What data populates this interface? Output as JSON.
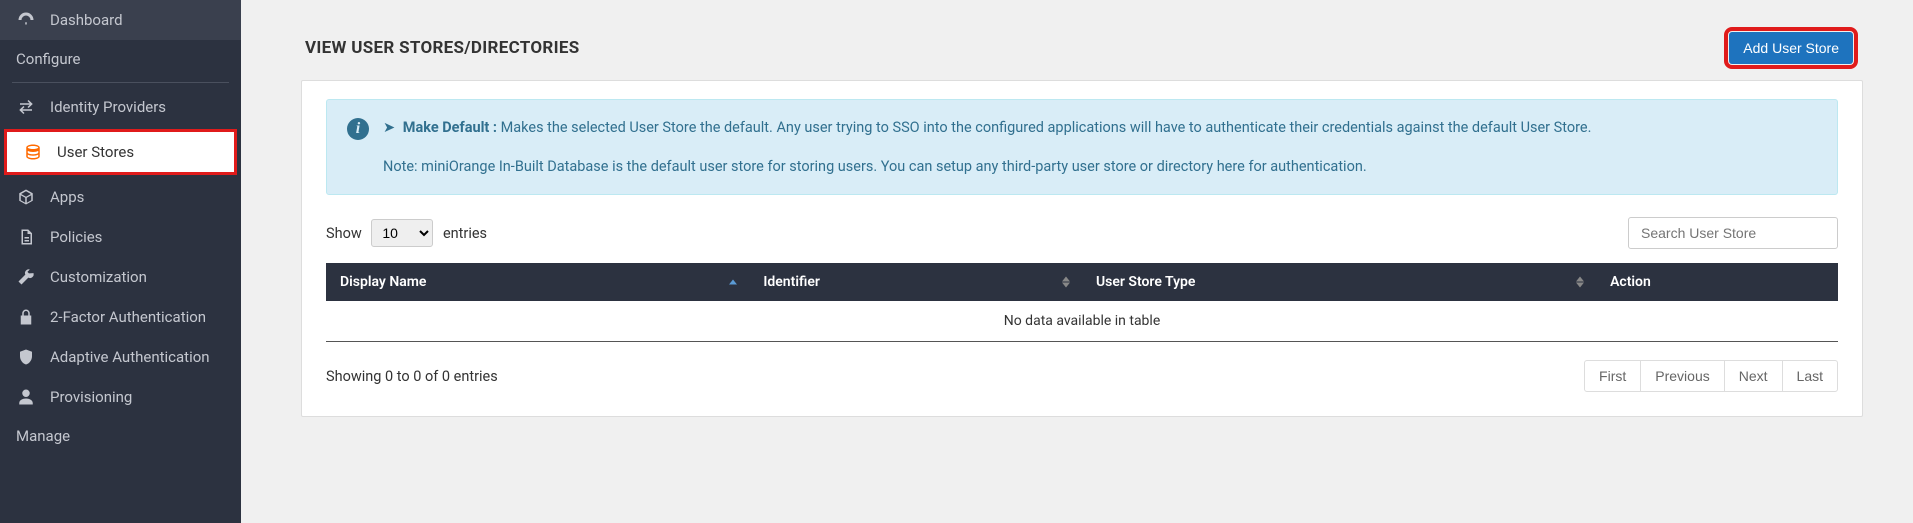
{
  "sidebar": {
    "items": [
      {
        "label": "Dashboard"
      },
      {
        "label": "Identity Providers"
      },
      {
        "label": "User Stores"
      },
      {
        "label": "Apps"
      },
      {
        "label": "Policies"
      },
      {
        "label": "Customization"
      },
      {
        "label": "2-Factor Authentication"
      },
      {
        "label": "Adaptive Authentication"
      },
      {
        "label": "Provisioning"
      }
    ],
    "section_configure": "Configure",
    "section_manage": "Manage"
  },
  "header": {
    "title": "VIEW USER STORES/DIRECTORIES",
    "add_button": "Add User Store"
  },
  "info": {
    "heading": "Make Default :",
    "body": "Makes the selected User Store the default. Any user trying to SSO into the configured applications will have to authenticate their credentials against the default User Store.",
    "note": "Note: miniOrange In-Built Database is the default user store for storing users. You can setup any third-party user store or directory here for authentication."
  },
  "table": {
    "show_label": "Show",
    "entries_label": "entries",
    "entries_value": "10",
    "search_placeholder": "Search User Store",
    "columns": [
      "Display Name",
      "Identifier",
      "User Store Type",
      "Action"
    ],
    "no_data": "No data available in table",
    "showing_text": "Showing 0 to 0 of 0 entries",
    "pagination": {
      "first": "First",
      "prev": "Previous",
      "next": "Next",
      "last": "Last"
    }
  }
}
